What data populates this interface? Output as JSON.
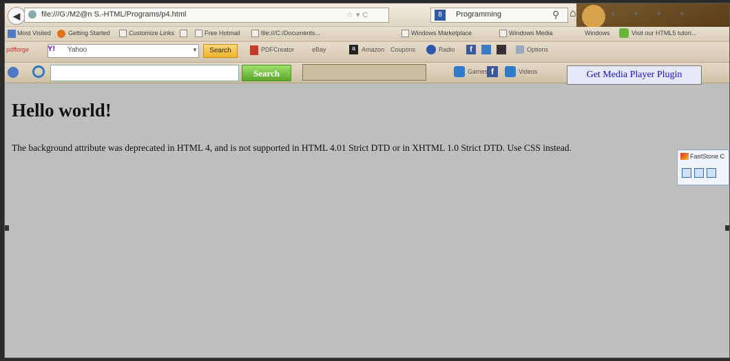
{
  "browser": {
    "url": "file:///G:/M2@n S.-HTML/Programs/p4.html",
    "search_engine_text": "Programming",
    "bookmarks": [
      "Most Visited",
      "Getting Started",
      "Customize Links",
      "Free Hotmail",
      "file:///C:/Documents...",
      "Windows Marketplace",
      "Windows Media",
      "Windows",
      "Visit our HTML5 tutori..."
    ]
  },
  "toolbar1": {
    "pdfforge_label": "pdfforge",
    "yahoo_text": "Yahoo",
    "search_button": "Search",
    "items": [
      "PDFCreator",
      "eBay",
      "Amazon",
      "Coupons",
      "Radio",
      "Options"
    ]
  },
  "toolbar2": {
    "search_button": "Search",
    "games_label": "Games",
    "videos_label": "Videos",
    "player_plugin": "Get Media Player Plugin"
  },
  "page": {
    "heading": "Hello world!",
    "paragraph": "The background attribute was deprecated in HTML 4, and is not supported in HTML 4.01 Strict DTD or in XHTML 1.0 Strict DTD. Use CSS instead."
  },
  "faststone": {
    "title": "FastStone C"
  },
  "colors": {
    "page_background": "#bdbebe",
    "link_blue": "#1212cc"
  }
}
